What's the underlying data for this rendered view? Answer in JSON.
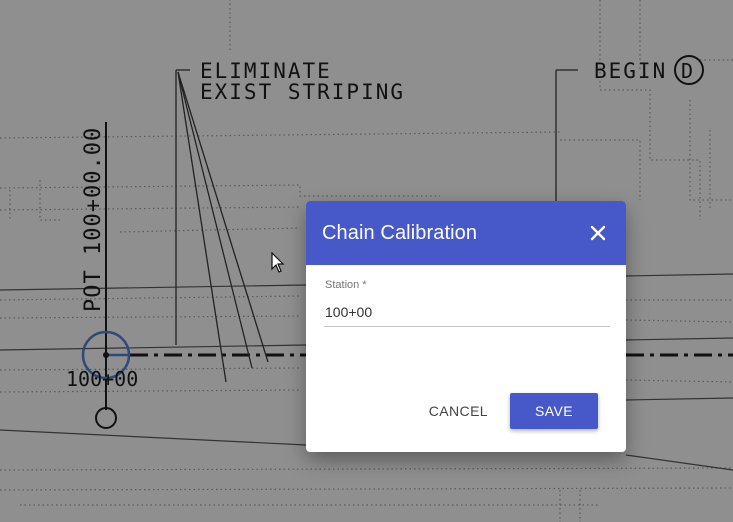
{
  "drawing": {
    "label_eliminate_1": "ELIMINATE",
    "label_eliminate_2": "EXIST STRIPING",
    "label_begin": "BEGIN",
    "label_begin_circle": "D",
    "label_pot": "POT 100+00.00",
    "label_station": "100+00"
  },
  "dialog": {
    "title": "Chain Calibration",
    "field_label": "Station *",
    "field_value": "100+00",
    "cancel_label": "CANCEL",
    "save_label": "SAVE"
  },
  "colors": {
    "accent": "#4758c8",
    "overlay_bg": "#8f8f8f"
  }
}
